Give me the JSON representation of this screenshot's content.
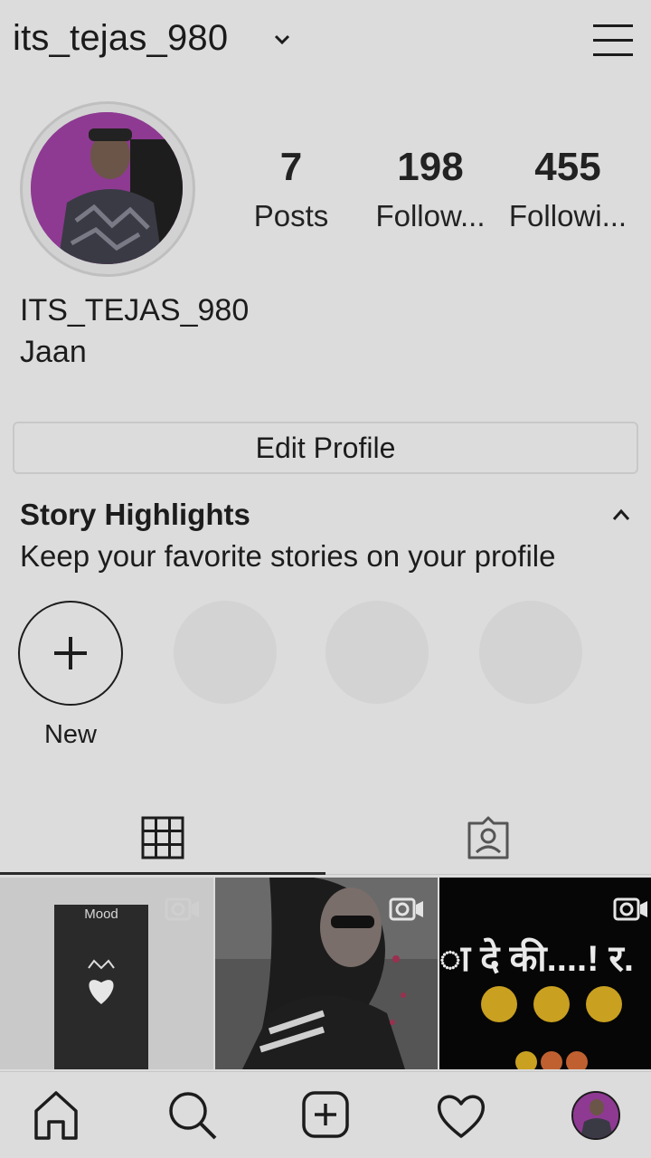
{
  "header": {
    "username": "its_tejas_980"
  },
  "profile": {
    "display_name": "ITS_TEJAS_980",
    "bio": "Jaan",
    "stats": [
      {
        "value": "7",
        "label": "Posts"
      },
      {
        "value": "198",
        "label": "Follow..."
      },
      {
        "value": "455",
        "label": "Followi..."
      }
    ],
    "edit_label": "Edit Profile"
  },
  "highlights": {
    "title": "Story Highlights",
    "subtitle": "Keep your favorite stories on your profile",
    "new_label": "New"
  },
  "posts": [
    {
      "caption": "Mood"
    },
    {
      "caption": ""
    },
    {
      "caption": "ा दे की....! र."
    }
  ],
  "icons": {
    "header": [
      "chevron-down-icon",
      "menu-icon"
    ],
    "tabs": [
      "grid-icon",
      "tagged-icon"
    ],
    "nav": [
      "home-icon",
      "search-icon",
      "add-post-icon",
      "heart-icon",
      "profile-avatar"
    ]
  },
  "colors": {
    "background": "#dcdcdc",
    "text": "#1c1c1c",
    "avatar_accent": "#8e3a92"
  }
}
